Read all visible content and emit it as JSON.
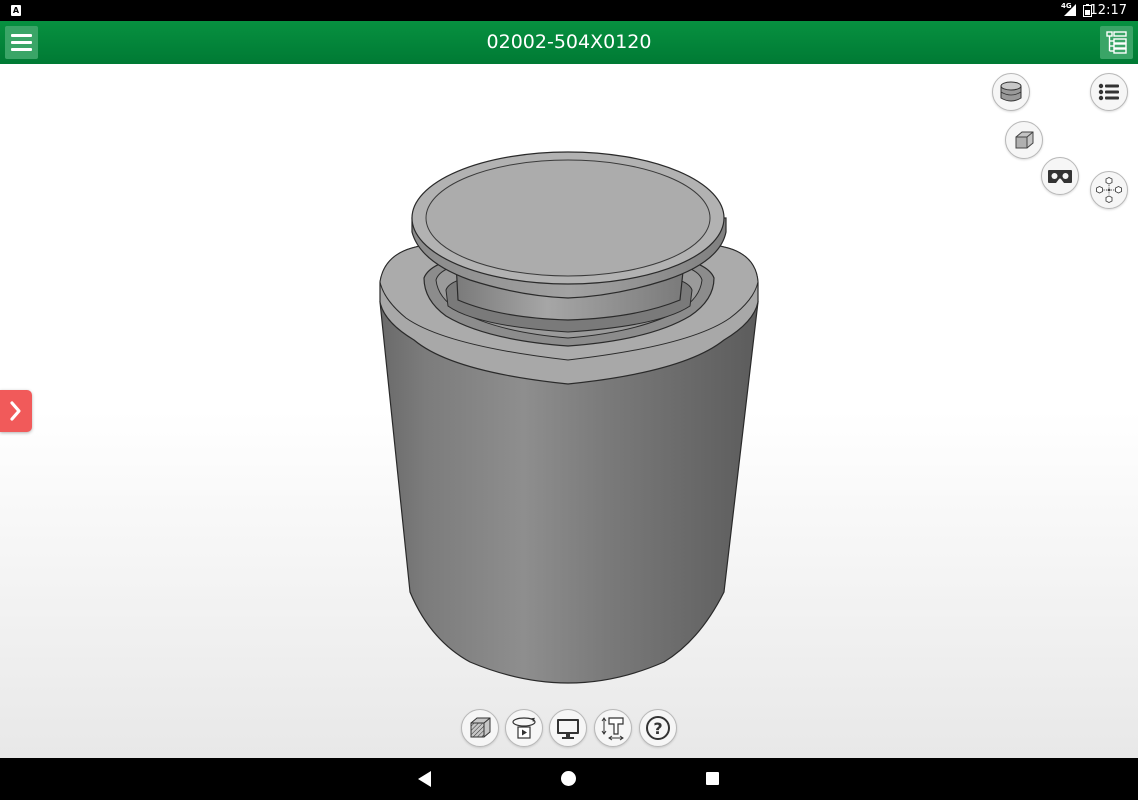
{
  "status_bar": {
    "notification_icon": "A",
    "network_type": "4G",
    "time": "12:17",
    "icons": [
      "notification-icon",
      "signal-icon",
      "battery-icon"
    ]
  },
  "app_bar": {
    "title": "02002-504X0120",
    "color": "#079140",
    "icons": [
      "hamburger-menu-icon",
      "tree-structure-icon"
    ]
  },
  "viewport": {
    "model_description_icon": "cylinder-weight",
    "right_toolbar": [
      "cylinder-view-icon",
      "list-icon",
      "cube-view-icon",
      "vr-headset-icon",
      "explode-view-icon"
    ],
    "bottom_toolbar": [
      "section-cut-icon",
      "rotate-animation-icon",
      "display-icon",
      "dimension-icon",
      "help-icon"
    ],
    "help_glyph": "?",
    "side_tab_glyph": "❯",
    "side_tab_color": "#f15a5a"
  },
  "nav_bar": {
    "icons": [
      "back-icon",
      "home-icon",
      "recents-icon"
    ]
  }
}
